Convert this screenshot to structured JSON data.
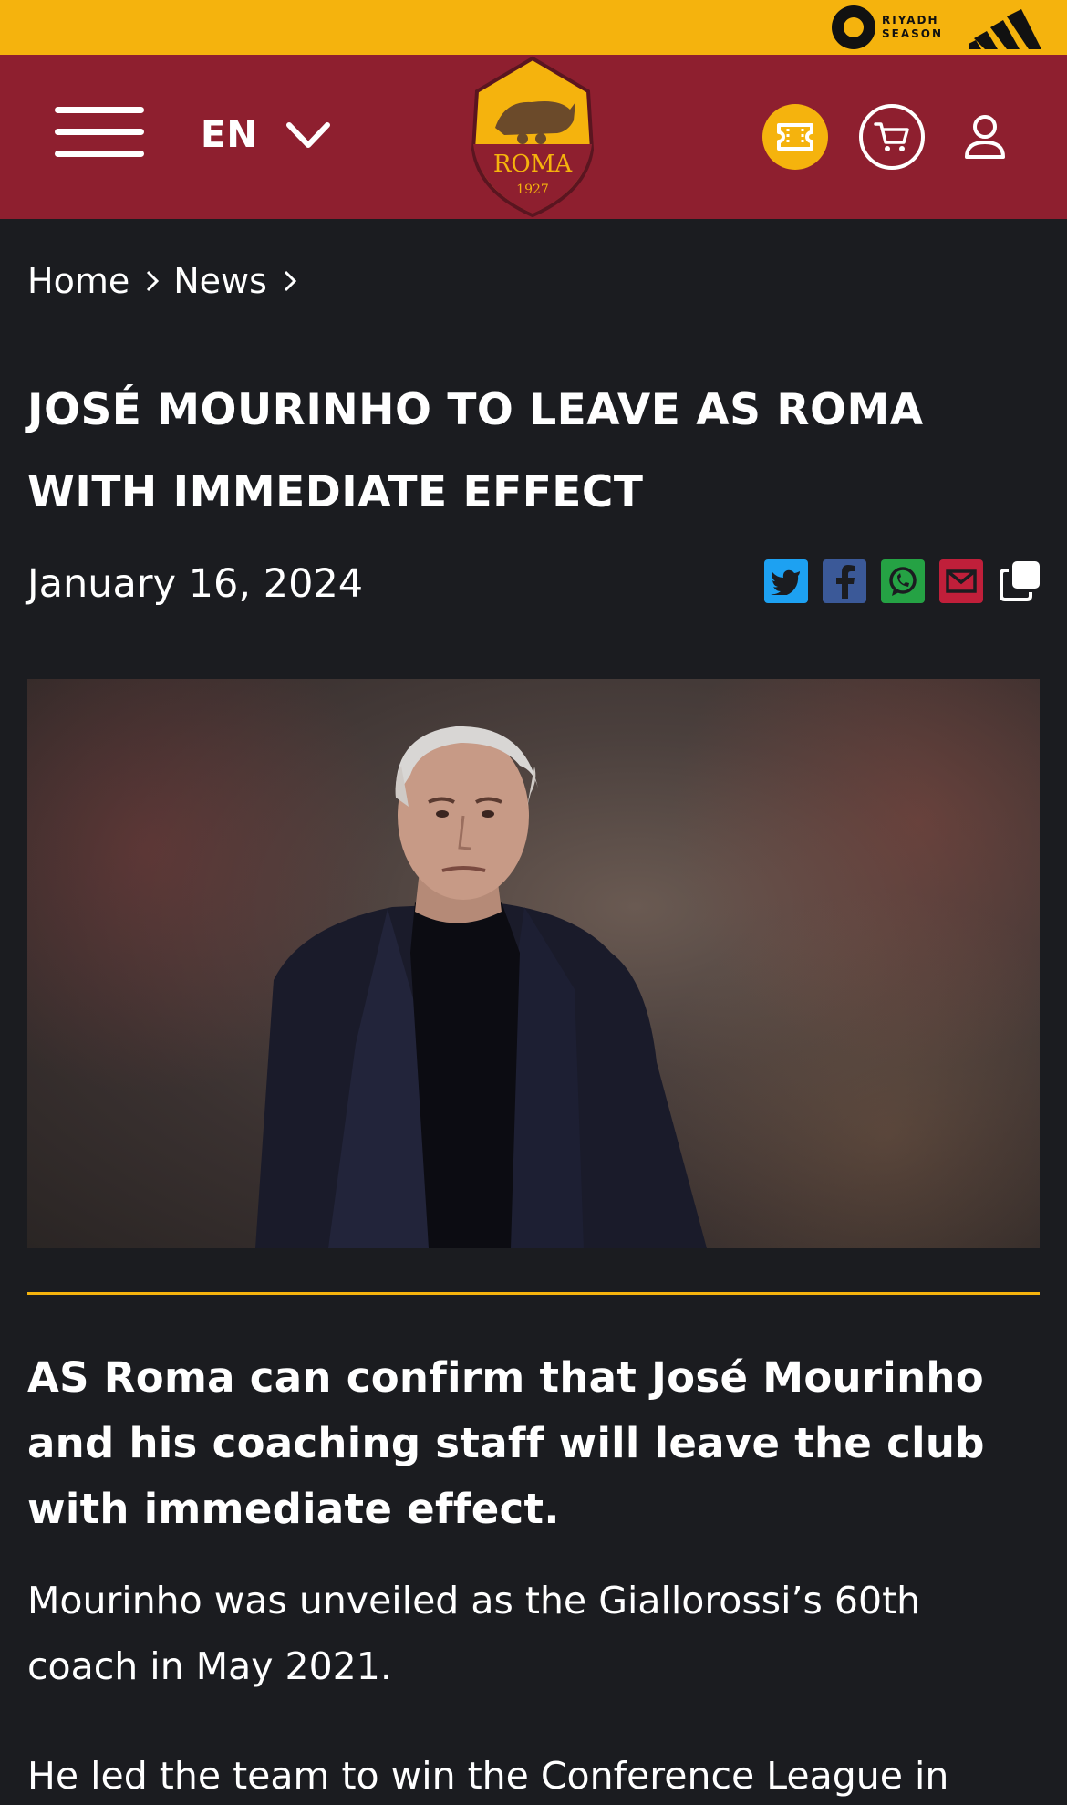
{
  "sponsor_bar": {
    "riyadh_text": "RIYADH SEASON",
    "background": "#f5b30d"
  },
  "nav": {
    "background": "#8e1f2f",
    "language": "EN",
    "crest_text": "ROMA",
    "crest_year": "1927",
    "icons": [
      "menu-icon",
      "chevron-down-icon",
      "ticket-icon",
      "cart-icon",
      "user-icon"
    ]
  },
  "breadcrumb": {
    "items": [
      "Home",
      "News"
    ]
  },
  "article": {
    "title": "JOSÉ MOURINHO TO LEAVE AS ROMA WITH IMMEDIATE EFFECT",
    "date": "January 16, 2024",
    "share_icons": [
      "twitter-icon",
      "facebook-icon",
      "whatsapp-icon",
      "email-icon",
      "copy-link-icon"
    ],
    "lead": "AS Roma can confirm that José Mourinho and his coaching staff will leave the club with immediate effect.",
    "paragraphs": [
      "Mourinho was unveiled as the Giallorossi’s 60th coach in May 2021.",
      "He led the team to win the Conference League in"
    ]
  },
  "colors": {
    "page_bg": "#1b1c20",
    "accent_yellow": "#f5b30d",
    "roma_red": "#8e1f2f",
    "twitter": "#1da1f2",
    "facebook": "#3b5998",
    "whatsapp": "#25a244",
    "email": "#c01f3a"
  }
}
